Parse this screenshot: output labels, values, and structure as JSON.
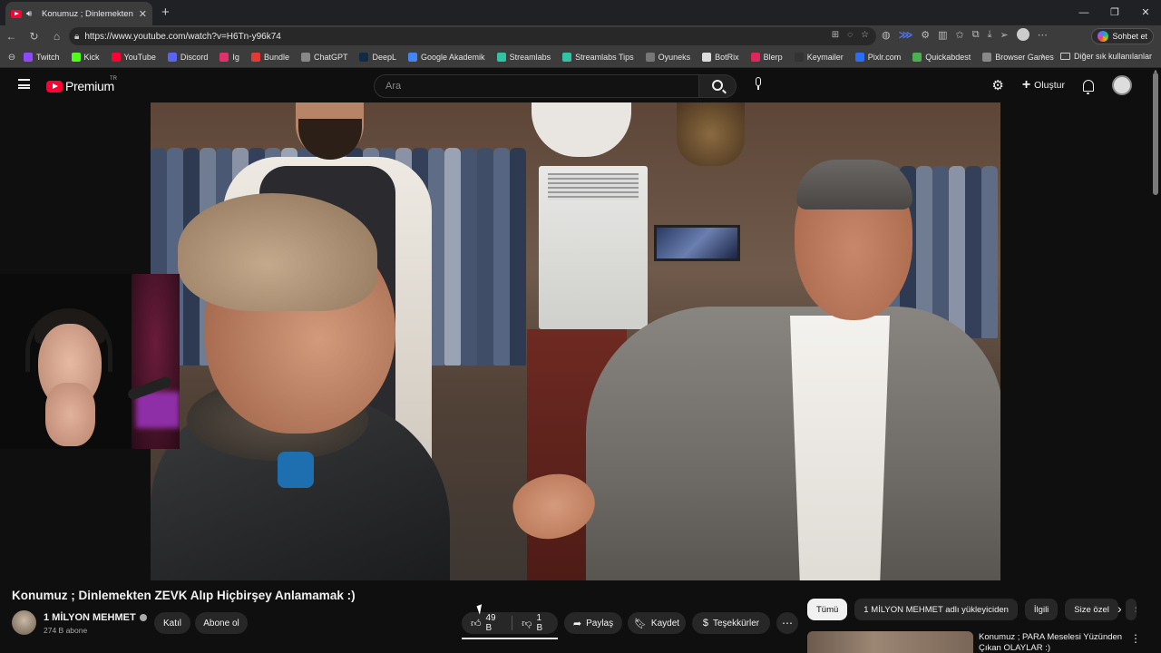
{
  "browser": {
    "tab_title": "Konumuz ; Dinlemekten ZEVK",
    "url": "https://www.youtube.com/watch?v=H6Tn-y96k74",
    "copilot_label": "Sohbet et",
    "bookmarks": [
      {
        "label": "Twitch",
        "color": "#9146ff"
      },
      {
        "label": "Kick",
        "color": "#53fc18"
      },
      {
        "label": "YouTube",
        "color": "#ff0033"
      },
      {
        "label": "Discord",
        "color": "#5865f2"
      },
      {
        "label": "Ig",
        "color": "#e1306c"
      },
      {
        "label": "Bundle",
        "color": "#e53935"
      },
      {
        "label": "ChatGPT",
        "color": "#888888"
      },
      {
        "label": "DeepL",
        "color": "#0f2b46"
      },
      {
        "label": "Google Akademik",
        "color": "#4285f4"
      },
      {
        "label": "Streamlabs",
        "color": "#31c3a2"
      },
      {
        "label": "Streamlabs Tips",
        "color": "#31c3a2"
      },
      {
        "label": "Oyuneks",
        "color": "#777777"
      },
      {
        "label": "BotRix",
        "color": "#dddddd"
      },
      {
        "label": "Blerp",
        "color": "#e0245e"
      },
      {
        "label": "Keymailer",
        "color": "#333333"
      },
      {
        "label": "Pixlr.com",
        "color": "#2a6ef5"
      },
      {
        "label": "Quickabdest",
        "color": "#4caf50"
      },
      {
        "label": "Browser Games",
        "color": "#888888"
      }
    ],
    "other_bookmarks": "Diğer sık kullanılanlar"
  },
  "youtube": {
    "logo_word": "Premium",
    "country_code": "TR",
    "search_placeholder": "Ara",
    "create_label": "Oluştur"
  },
  "video": {
    "title": "Konumuz ; Dinlemekten ZEVK Alıp Hiçbirşey Anlamamak :)",
    "channel": "1 MİLYON MEHMET",
    "subscribers": "274 B abone",
    "join_label": "Katıl",
    "subscribe_label": "Abone ol",
    "likes": "49 B",
    "dislikes": "1 B",
    "share_label": "Paylaş",
    "save_label": "Kaydet",
    "thanks_label": "Teşekkürler"
  },
  "chips": [
    "Tümü",
    "1 MİLYON MEHMET adlı yükleyiciden",
    "İlgili",
    "Size özel",
    "S"
  ],
  "recommendation": {
    "title": "Konumuz ; PARA Meselesi Yüzünden Çıkan OLAYLAR :)"
  }
}
